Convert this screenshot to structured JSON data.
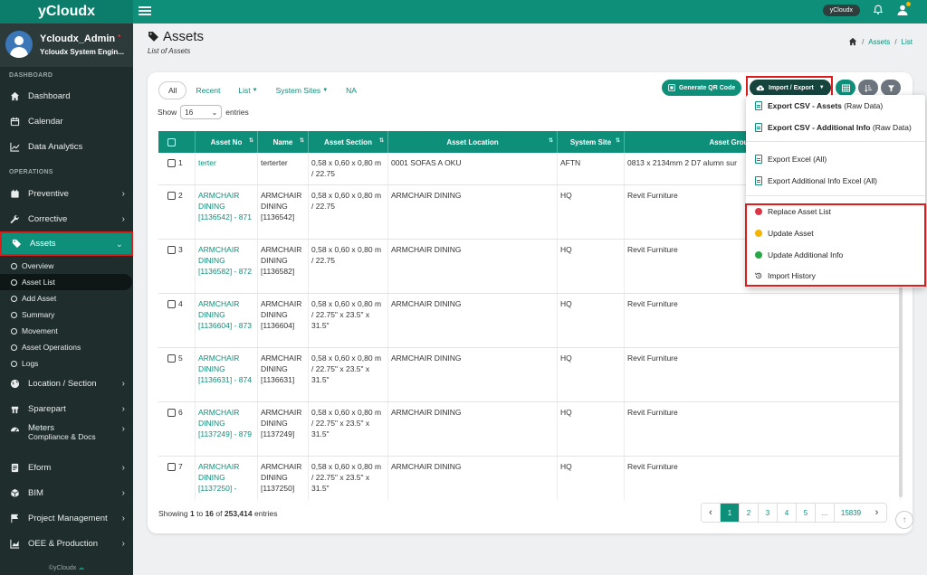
{
  "app": {
    "brand": "yCloudx",
    "tenant_badge": "yCloudx"
  },
  "profile": {
    "name": "Ycloudx_Admin",
    "status_mark": "*",
    "role": "Ycloudx System Engin..."
  },
  "sidebar": {
    "section_dashboard": "DASHBOARD",
    "section_operations": "OPERATIONS",
    "items": {
      "dashboard": "Dashboard",
      "calendar": "Calendar",
      "analytics": "Data Analytics",
      "preventive": "Preventive",
      "corrective": "Corrective",
      "assets": "Assets",
      "location": "Location / Section",
      "sparepart": "Sparepart",
      "meters": "Meters",
      "compliance": "Compliance & Docs",
      "eform": "Eform",
      "bim": "BIM",
      "project": "Project Management",
      "oee": "OEE & Production"
    },
    "asset_sub": [
      "Overview",
      "Asset List",
      "Add Asset",
      "Summary",
      "Movement",
      "Asset Operations",
      "Logs"
    ],
    "copyright": "©yCloudx"
  },
  "header": {
    "title": "Assets",
    "subtitle": "List of Assets",
    "breadcrumb": [
      "Assets",
      "List"
    ],
    "breadcrumb_sep": "/"
  },
  "tabs": [
    {
      "label": "All",
      "dropdown": false
    },
    {
      "label": "Recent",
      "dropdown": false
    },
    {
      "label": "List",
      "dropdown": true
    },
    {
      "label": "System Sites",
      "dropdown": true
    },
    {
      "label": "NA",
      "dropdown": false
    }
  ],
  "toolbar": {
    "qr_label": "Generate QR Code",
    "import_export_label": "Import / Export"
  },
  "length": {
    "show": "Show",
    "value": "16",
    "entries": "entries"
  },
  "table": {
    "headers": [
      "Asset No",
      "Name",
      "Asset Section",
      "Asset Location",
      "System Site",
      "Asset Grou"
    ],
    "rows": [
      {
        "idx": "1",
        "asset_no": "terter",
        "name": "terterter",
        "section": "0,58 x 0,60 x 0,80 m / 22.75",
        "location": "0001 SOFAS A OKU",
        "site": "AFTN",
        "group": "0813 x 2134mm 2 D7 alumn sur"
      },
      {
        "idx": "2",
        "asset_no": "ARMCHAIR DINING [1136542] - 871",
        "name": "ARMCHAIR DINING [1136542]",
        "section": "0,58 x 0,60 x 0,80 m / 22.75",
        "location": "ARMCHAIR DINING",
        "site": "HQ",
        "group": "Revit Furniture"
      },
      {
        "idx": "3",
        "asset_no": "ARMCHAIR DINING [1136582] - 872",
        "name": "ARMCHAIR DINING [1136582]",
        "section": "0,58 x 0,60 x 0,80 m / 22.75",
        "location": "ARMCHAIR DINING",
        "site": "HQ",
        "group": "Revit Furniture"
      },
      {
        "idx": "4",
        "asset_no": "ARMCHAIR DINING [1136604] - 873",
        "name": "ARMCHAIR DINING [1136604]",
        "section": "0,58 x 0,60 x 0,80 m / 22.75\" x 23.5\" x 31.5\"",
        "location": "ARMCHAIR DINING",
        "site": "HQ",
        "group": "Revit Furniture"
      },
      {
        "idx": "5",
        "asset_no": "ARMCHAIR DINING [1136631] - 874",
        "name": "ARMCHAIR DINING [1136631]",
        "section": "0,58 x 0,60 x 0,80 m / 22.75\" x 23.5\" x 31.5\"",
        "location": "ARMCHAIR DINING",
        "site": "HQ",
        "group": "Revit Furniture"
      },
      {
        "idx": "6",
        "asset_no": "ARMCHAIR DINING [1137249] - 879",
        "name": "ARMCHAIR DINING [1137249]",
        "section": "0,58 x 0,60 x 0,80 m / 22.75\" x 23.5\" x 31.5\"",
        "location": "ARMCHAIR DINING",
        "site": "HQ",
        "group": "Revit Furniture"
      },
      {
        "idx": "7",
        "asset_no": "ARMCHAIR DINING [1137250] -",
        "name": "ARMCHAIR DINING [1137250]",
        "section": "0,58 x 0,60 x 0,80 m / 22.75\" x 23.5\" x 31.5\"",
        "location": "ARMCHAIR DINING",
        "site": "HQ",
        "group": "Revit Furniture"
      }
    ]
  },
  "footer": {
    "showing_prefix": "Showing",
    "showing_from": "1",
    "showing_to_word": "to",
    "showing_to": "16",
    "showing_of_word": "of",
    "total": "253,414",
    "showing_suffix": "entries"
  },
  "pagination": {
    "pages": [
      "1",
      "2",
      "3",
      "4",
      "5",
      "...",
      "15839"
    ],
    "current": "1"
  },
  "dropdown": {
    "export_csv_assets_bold": "Export CSV - Assets",
    "export_csv_assets_rest": "(Raw Data)",
    "export_csv_addl_bold": "Export CSV - Additional Info",
    "export_csv_addl_rest": "(Raw Data)",
    "export_excel": "Export Excel (All)",
    "export_addl_excel": "Export Additional Info Excel (All)",
    "replace": "Replace Asset List",
    "update_asset": "Update Asset",
    "update_addl": "Update Additional Info",
    "history": "Import History"
  },
  "colors": {
    "primary": "#0e8f7a",
    "sidebar": "#1f2d2c",
    "highlight": "#e01b1b",
    "dot_red": "#dc3545",
    "dot_yellow": "#f4b400",
    "dot_green": "#28a745"
  }
}
